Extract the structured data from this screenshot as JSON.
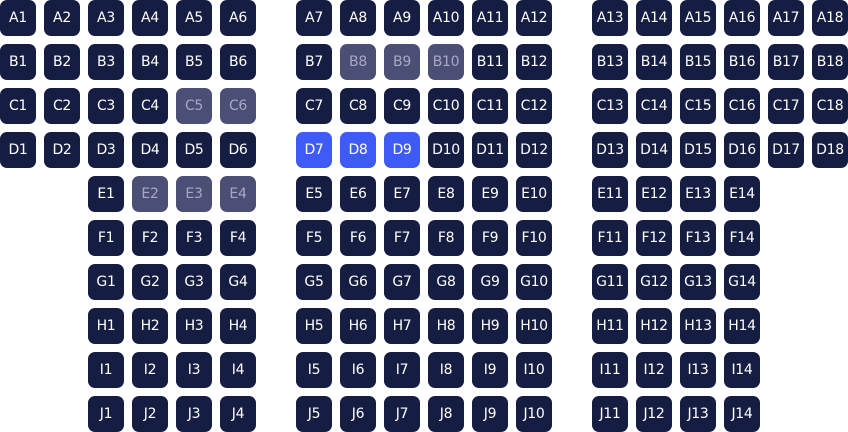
{
  "colors": {
    "available": "#161d42",
    "unavailable": "#4b4f76",
    "selected": "#3e5cf5"
  },
  "rows": [
    {
      "row": "A",
      "seats": [
        "A1",
        "A2",
        "A3",
        "A4",
        "A5",
        "A6",
        "A7",
        "A8",
        "A9",
        "A10",
        "A11",
        "A12",
        "A13",
        "A14",
        "A15",
        "A16",
        "A17",
        "A18"
      ]
    },
    {
      "row": "B",
      "seats": [
        "B1",
        "B2",
        "B3",
        "B4",
        "B5",
        "B6",
        "B7",
        "B8",
        "B9",
        "B10",
        "B11",
        "B12",
        "B13",
        "B14",
        "B15",
        "B16",
        "B17",
        "B18"
      ]
    },
    {
      "row": "C",
      "seats": [
        "C1",
        "C2",
        "C3",
        "C4",
        "C5",
        "C6",
        "C7",
        "C8",
        "C9",
        "C10",
        "C11",
        "C12",
        "C13",
        "C14",
        "C15",
        "C16",
        "C17",
        "C18"
      ]
    },
    {
      "row": "D",
      "seats": [
        "D1",
        "D2",
        "D3",
        "D4",
        "D5",
        "D6",
        "D7",
        "D8",
        "D9",
        "D10",
        "D11",
        "D12",
        "D13",
        "D14",
        "D15",
        "D16",
        "D17",
        "D18"
      ]
    },
    {
      "row": "E",
      "seats": [
        "E1",
        "E2",
        "E3",
        "E4",
        "E5",
        "E6",
        "E7",
        "E8",
        "E9",
        "E10",
        "E11",
        "E12",
        "E13",
        "E14"
      ]
    },
    {
      "row": "F",
      "seats": [
        "F1",
        "F2",
        "F3",
        "F4",
        "F5",
        "F6",
        "F7",
        "F8",
        "F9",
        "F10",
        "F11",
        "F12",
        "F13",
        "F14"
      ]
    },
    {
      "row": "G",
      "seats": [
        "G1",
        "G2",
        "G3",
        "G4",
        "G5",
        "G6",
        "G7",
        "G8",
        "G9",
        "G10",
        "G11",
        "G12",
        "G13",
        "G14"
      ]
    },
    {
      "row": "H",
      "seats": [
        "H1",
        "H2",
        "H3",
        "H4",
        "H5",
        "H6",
        "H7",
        "H8",
        "H9",
        "H10",
        "H11",
        "H12",
        "H13",
        "H14"
      ]
    },
    {
      "row": "I",
      "seats": [
        "I1",
        "I2",
        "I3",
        "I4",
        "I5",
        "I6",
        "I7",
        "I8",
        "I9",
        "I10",
        "I11",
        "I12",
        "I13",
        "I14"
      ]
    },
    {
      "row": "J",
      "seats": [
        "J1",
        "J2",
        "J3",
        "J4",
        "J5",
        "J6",
        "J7",
        "J8",
        "J9",
        "J10",
        "J11",
        "J12",
        "J13",
        "J14"
      ]
    }
  ],
  "unavailable_seats": [
    "B8",
    "B9",
    "B10",
    "C5",
    "C6",
    "E2",
    "E3",
    "E4"
  ],
  "selected_seats": [
    "D7",
    "D8",
    "D9"
  ]
}
